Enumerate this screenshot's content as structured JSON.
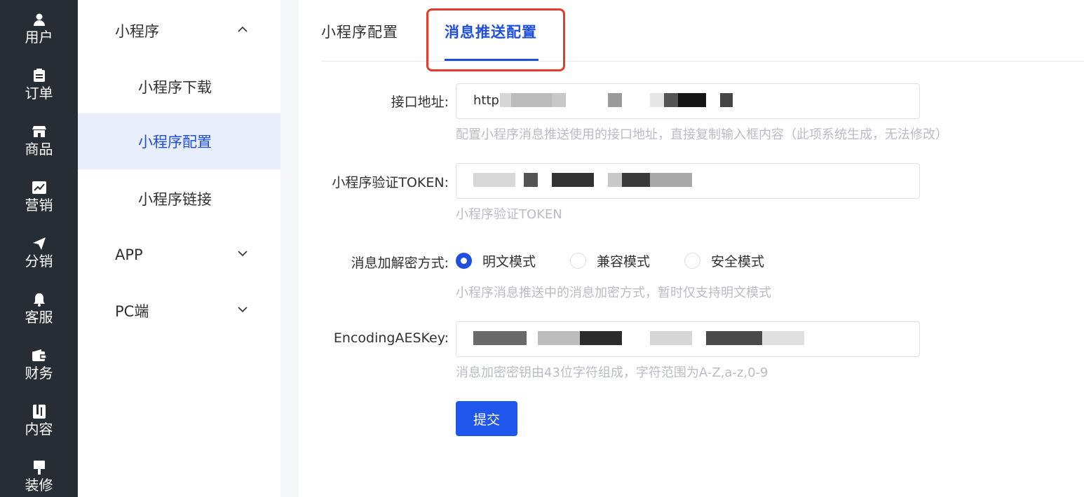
{
  "rail": {
    "items": [
      {
        "label": "用户",
        "icon": "user-icon"
      },
      {
        "label": "订单",
        "icon": "clipboard-icon"
      },
      {
        "label": "商品",
        "icon": "shop-icon"
      },
      {
        "label": "营销",
        "icon": "chart-icon"
      },
      {
        "label": "分销",
        "icon": "send-icon"
      },
      {
        "label": "客服",
        "icon": "bell-icon"
      },
      {
        "label": "财务",
        "icon": "wallet-icon"
      },
      {
        "label": "内容",
        "icon": "book-icon"
      },
      {
        "label": "装修",
        "icon": "brush-icon"
      }
    ]
  },
  "submenu": {
    "group_miniprogram": "小程序",
    "items": [
      "小程序下载",
      "小程序配置",
      "小程序链接"
    ],
    "group_app": "APP",
    "group_pc": "PC端"
  },
  "tabs": {
    "config": "小程序配置",
    "push": "消息推送配置"
  },
  "form": {
    "url_label": "接口地址:",
    "url_value": "http",
    "url_help": "配置小程序消息推送使用的接口地址，直接复制输入框内容（此项系统生成，无法修改）",
    "token_label": "小程序验证TOKEN:",
    "token_help": "小程序验证TOKEN",
    "mode_label": "消息加解密方式:",
    "mode_options": [
      "明文模式",
      "兼容模式",
      "安全模式"
    ],
    "mode_selected": "明文模式",
    "mode_help": "小程序消息推送中的消息加密方式，暂时仅支持明文模式",
    "aes_label": "EncodingAESKey:",
    "aes_help": "消息加密密钥由43位字符组成，字符范围为A-Z,a-z,0-9",
    "submit": "提交"
  },
  "colors": {
    "accent": "#1f4fe0",
    "highlight_border": "#e43b2c",
    "rail_bg": "#282c33"
  }
}
